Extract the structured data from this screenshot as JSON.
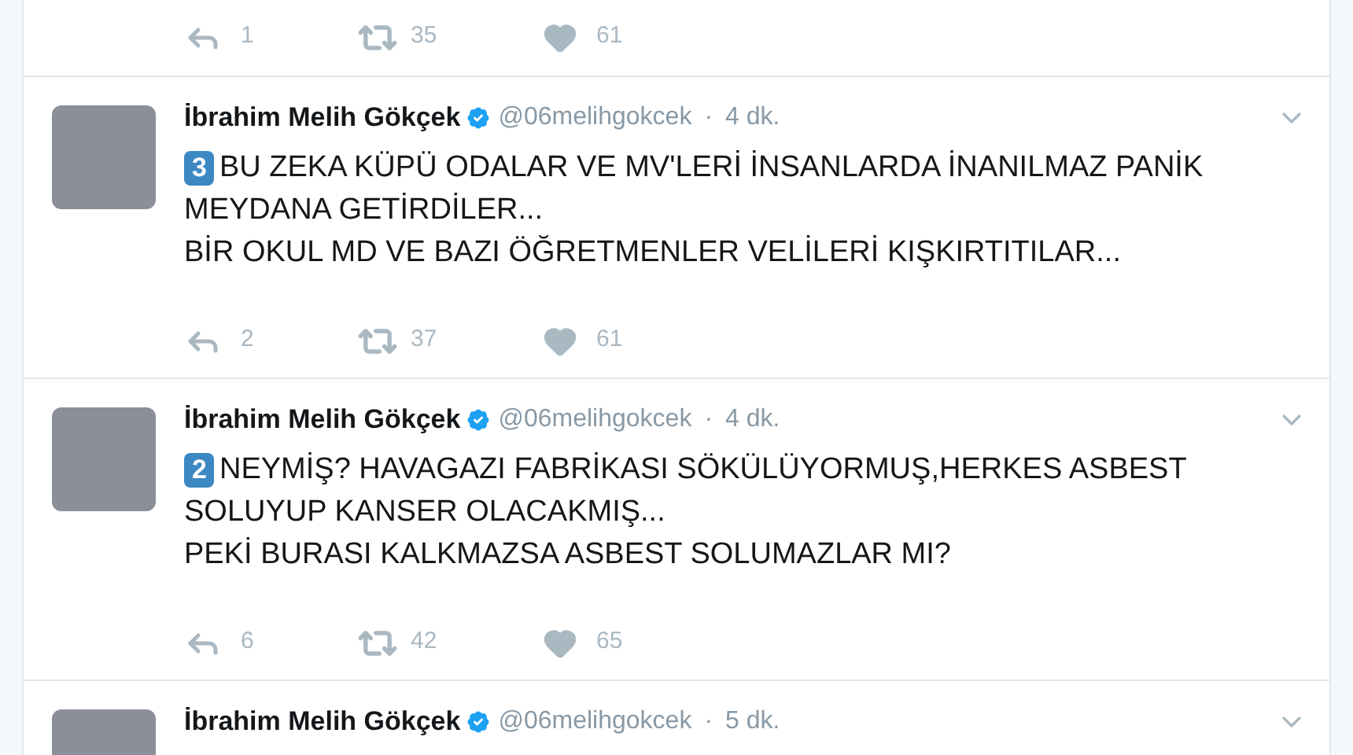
{
  "previous_tweet_actions": {
    "replies": "1",
    "retweets": "35",
    "likes": "61"
  },
  "tweets": [
    {
      "name": "İbrahim Melih Gökçek",
      "verified": true,
      "handle": "@06melihgokcek",
      "separator": "·",
      "time": "4 dk.",
      "number": "3",
      "paragraphs": [
        "BU ZEKA KÜPÜ ODALAR VE MV'LERİ İNSANLARDA İNANILMAZ PANİK MEYDANA GETİRDİLER...",
        "BİR OKUL MD VE BAZI ÖĞRETMENLER VELİLERİ KIŞKIRTITILAR..."
      ],
      "replies": "2",
      "retweets": "37",
      "likes": "61"
    },
    {
      "name": "İbrahim Melih Gökçek",
      "verified": true,
      "handle": "@06melihgokcek",
      "separator": "·",
      "time": "4 dk.",
      "number": "2",
      "paragraphs": [
        "NEYMİŞ? HAVAGAZI FABRİKASI SÖKÜLÜYORMUŞ,HERKES ASBEST SOLUYUP KANSER OLACAKMIŞ...",
        "PEKİ BURASI KALKMAZSA ASBEST SOLUMAZLAR MI?"
      ],
      "replies": "6",
      "retweets": "42",
      "likes": "65"
    },
    {
      "name": "İbrahim Melih Gökçek",
      "verified": true,
      "handle": "@06melihgokcek",
      "separator": "·",
      "time": "5 dk."
    }
  ]
}
